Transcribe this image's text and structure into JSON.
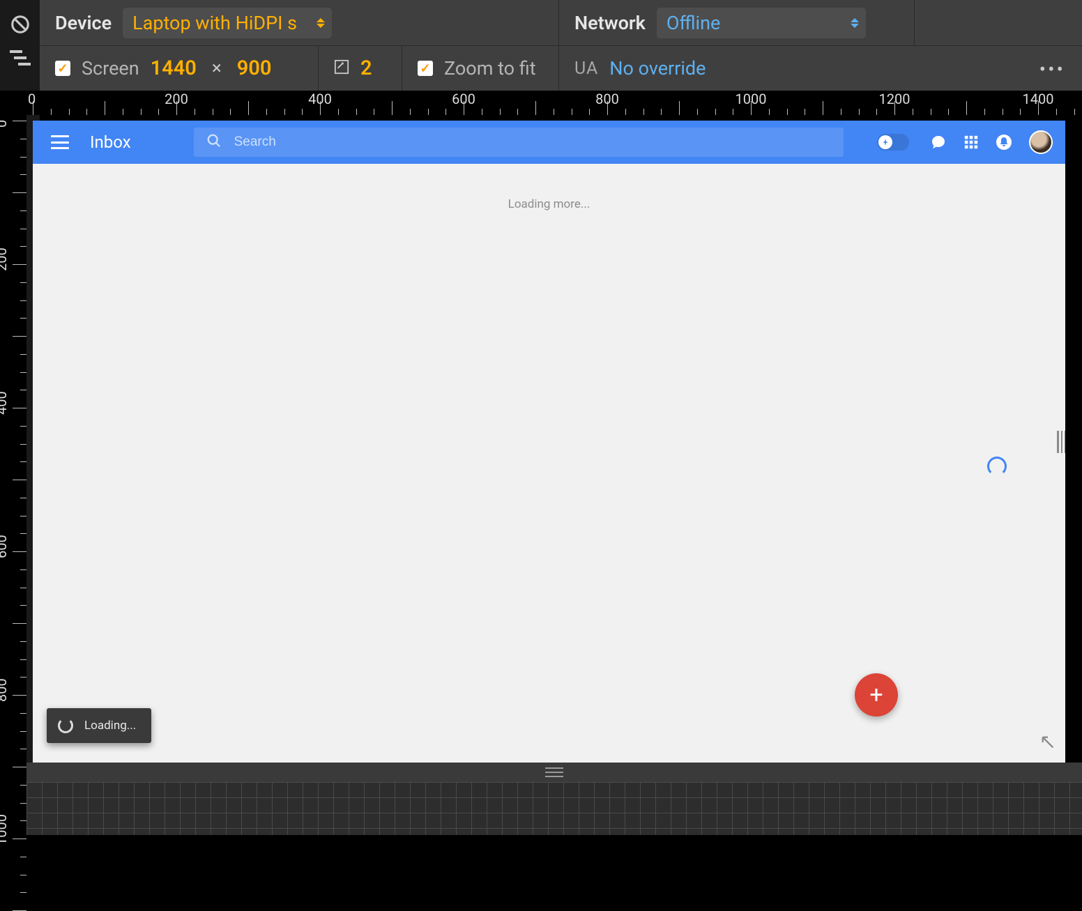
{
  "devtools": {
    "device_label": "Device",
    "device_value": "Laptop with HiDPI s",
    "network_label": "Network",
    "network_value": "Offline",
    "screen_label": "Screen",
    "width": "1440",
    "height": "900",
    "dpr": "2",
    "zoom_label": "Zoom to fit",
    "ua_label": "UA",
    "ua_value": "No override"
  },
  "ruler": {
    "h_labels": [
      "0",
      "200",
      "400",
      "600",
      "800",
      "1000",
      "1200",
      "1400"
    ],
    "v_labels": [
      "0",
      "200",
      "400",
      "600",
      "800",
      "1000"
    ]
  },
  "inbox": {
    "title": "Inbox",
    "search_placeholder": "Search",
    "loading_more": "Loading more...",
    "toast_text": "Loading...",
    "fab_symbol": "+"
  }
}
